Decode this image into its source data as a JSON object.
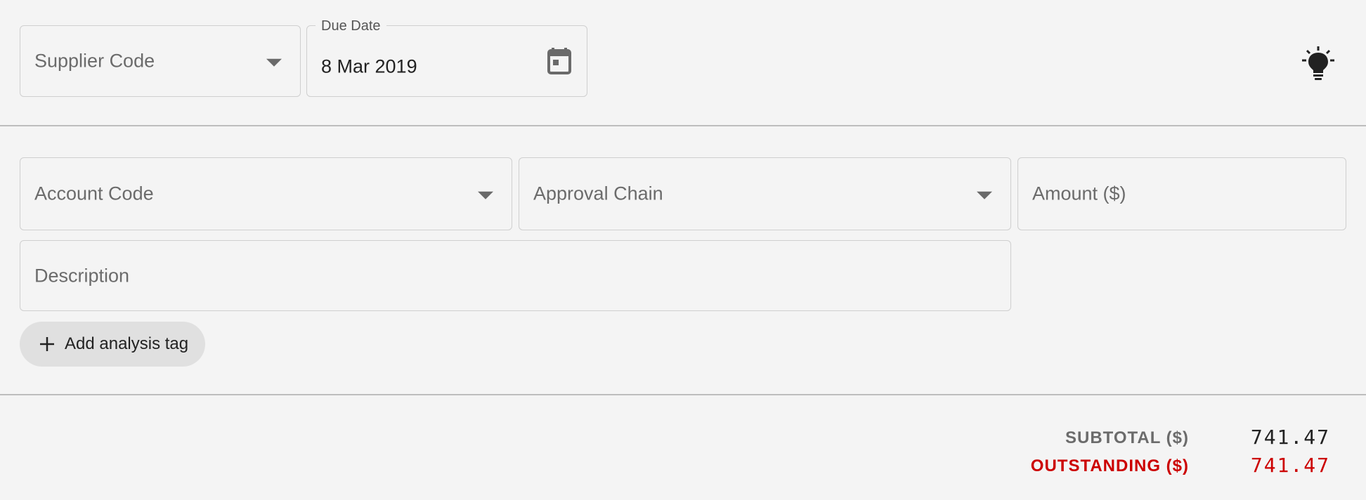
{
  "header": {
    "supplier_code": {
      "placeholder": "Supplier Code"
    },
    "due_date": {
      "label": "Due Date",
      "value": "8 Mar 2019"
    },
    "icons": {
      "calendar": "calendar-icon",
      "lightbulb": "lightbulb-icon"
    }
  },
  "line_item": {
    "account_code": {
      "placeholder": "Account Code"
    },
    "approval_chain": {
      "placeholder": "Approval Chain"
    },
    "amount": {
      "placeholder": "Amount ($)"
    },
    "description": {
      "placeholder": "Description"
    },
    "add_tag_label": "Add analysis tag"
  },
  "totals": {
    "subtotal_label": "SUBTOTAL ($)",
    "subtotal_value": "741.47",
    "outstanding_label": "OUTSTANDING ($)",
    "outstanding_value": "741.47"
  },
  "colors": {
    "background": "#f4f4f4",
    "outstanding": "#cc0000",
    "subtotal_label": "#6b6b6b"
  }
}
